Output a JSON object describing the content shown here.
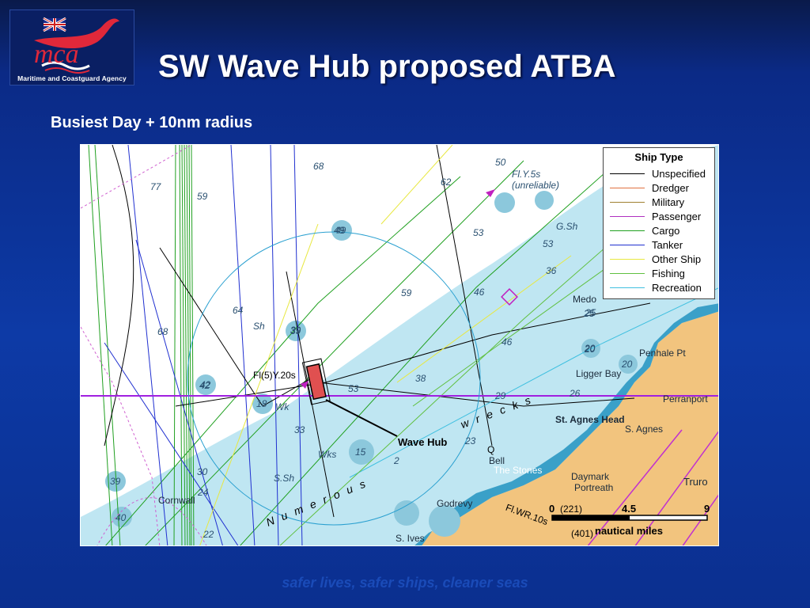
{
  "logo": {
    "name": "mca",
    "agency": "Maritime and Coastguard Agency"
  },
  "title": "SW Wave Hub proposed ATBA",
  "subtitle": "Busiest Day + 10nm radius",
  "legend": {
    "title": "Ship Type",
    "items": [
      {
        "label": "Unspecified",
        "color": "#000000"
      },
      {
        "label": "Dredger",
        "color": "#e07040"
      },
      {
        "label": "Military",
        "color": "#a08030"
      },
      {
        "label": "Passenger",
        "color": "#b030c0"
      },
      {
        "label": "Cargo",
        "color": "#20a020"
      },
      {
        "label": "Tanker",
        "color": "#2030d0"
      },
      {
        "label": "Other Ship",
        "color": "#e8e840"
      },
      {
        "label": "Fishing",
        "color": "#60c040"
      },
      {
        "label": "Recreation",
        "color": "#40c0e0"
      }
    ]
  },
  "map": {
    "wave_hub_label": "Wave Hub",
    "scale": {
      "ticks": [
        "0",
        "4.5",
        "9"
      ],
      "units": "nautical miles"
    },
    "soundings": [
      "77",
      "59",
      "68",
      "62",
      "50",
      "53",
      "49",
      "53",
      "36",
      "46",
      "64",
      "39",
      "68",
      "59",
      "42",
      "38",
      "46",
      "53",
      "33",
      "23",
      "24",
      "39",
      "40",
      "30",
      "22",
      "20",
      "25"
    ],
    "circled_depths": [
      "49",
      "39",
      "42",
      "18",
      "15",
      "20",
      "20",
      "26",
      "25"
    ],
    "places": [
      "Penhale Pt",
      "Perranport",
      "S. Agnes",
      "St. Agnes Head",
      "Ligger Bay",
      "Truro",
      "Daymark",
      "Portreath",
      "Godrevy",
      "The Stones",
      "Bell",
      "Medo",
      "S. Ives",
      "Cornwall"
    ],
    "chart_notes": [
      "Fl.Y.5s",
      "(unreliable)",
      "G.Sh",
      "Fl(5)Y.20s",
      "Wks",
      "Wk",
      "Sh",
      "S.Sh",
      "N u m e r o u s",
      "w r e c k s"
    ],
    "misc": [
      "(221)",
      "(401)",
      "Fl.WR.10s",
      "Q",
      "29",
      "2"
    ]
  },
  "tagline": "safer lives, safer ships, cleaner seas",
  "colors": {
    "background": "#0d3aa6",
    "sea_shallow": "#bfe6f2",
    "land": "#f2c47e",
    "atba_circle": "#2aa0d0",
    "wave_hub_box": "#e05050"
  }
}
